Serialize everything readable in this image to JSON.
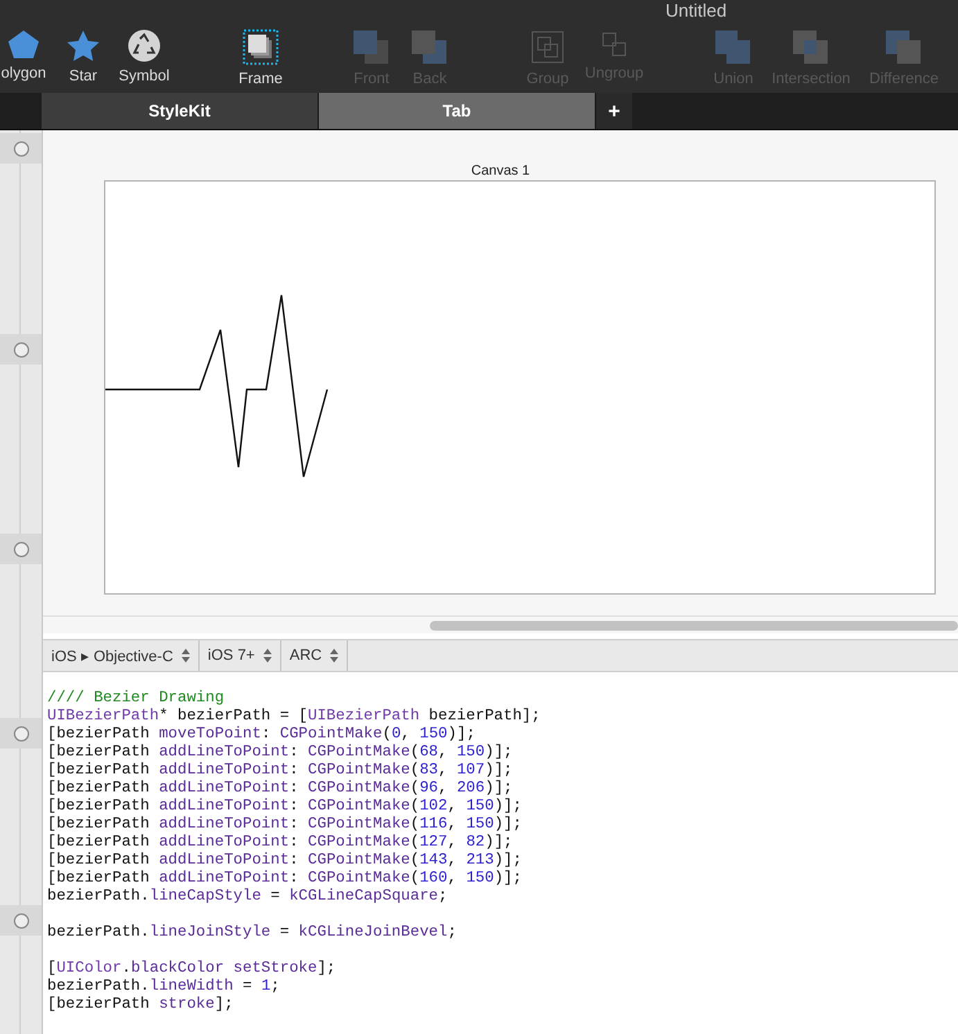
{
  "window": {
    "title": "Untitled"
  },
  "toolbar": {
    "groups": [
      {
        "items": [
          {
            "kind": "polygon",
            "label": "olygon",
            "disabled": false
          },
          {
            "kind": "star",
            "label": "Star",
            "disabled": false
          },
          {
            "kind": "symbol",
            "label": "Symbol",
            "disabled": false
          }
        ]
      },
      {
        "items": [
          {
            "kind": "frame",
            "label": "Frame",
            "disabled": false
          }
        ]
      },
      {
        "items": [
          {
            "kind": "front",
            "label": "Front",
            "disabled": true
          },
          {
            "kind": "back",
            "label": "Back",
            "disabled": true
          }
        ]
      },
      {
        "items": [
          {
            "kind": "group",
            "label": "Group",
            "disabled": true
          },
          {
            "kind": "ungroup",
            "label": "Ungroup",
            "disabled": true
          }
        ]
      },
      {
        "items": [
          {
            "kind": "union",
            "label": "Union",
            "disabled": true
          },
          {
            "kind": "intersection",
            "label": "Intersection",
            "disabled": true
          },
          {
            "kind": "difference",
            "label": "Difference",
            "disabled": true
          }
        ]
      }
    ]
  },
  "tabs": [
    {
      "label": "StyleKit",
      "selected": false
    },
    {
      "label": "Tab",
      "selected": true
    }
  ],
  "add_tab": "+",
  "canvas": {
    "title": "Canvas 1"
  },
  "code_options": [
    "iOS ▸ Objective-C",
    "iOS 7+",
    "ARC"
  ],
  "code": [
    {
      "lines": [
        [
          {
            "kind": "comment",
            "text": "//// Bezier Drawing"
          }
        ],
        [
          {
            "kind": "type",
            "text": "UIBezierPath"
          },
          {
            "kind": "plain",
            "text": "* bezierPath = ["
          },
          {
            "kind": "type",
            "text": "UIBezierPath"
          },
          {
            "kind": "plain",
            "text": " bezierPath];"
          }
        ],
        [
          {
            "kind": "plain",
            "text": "[bezierPath "
          },
          {
            "kind": "call",
            "text": "moveToPoint"
          },
          {
            "kind": "plain",
            "text": ": "
          },
          {
            "kind": "call",
            "text": "CGPointMake"
          },
          {
            "kind": "plain",
            "text": "("
          },
          {
            "kind": "number",
            "text": "0"
          },
          {
            "kind": "plain",
            "text": ", "
          },
          {
            "kind": "number",
            "text": "150"
          },
          {
            "kind": "plain",
            "text": ")];"
          }
        ],
        [
          {
            "kind": "plain",
            "text": "[bezierPath "
          },
          {
            "kind": "call",
            "text": "addLineToPoint"
          },
          {
            "kind": "plain",
            "text": ": "
          },
          {
            "kind": "call",
            "text": "CGPointMake"
          },
          {
            "kind": "plain",
            "text": "("
          },
          {
            "kind": "number",
            "text": "68"
          },
          {
            "kind": "plain",
            "text": ", "
          },
          {
            "kind": "number",
            "text": "150"
          },
          {
            "kind": "plain",
            "text": ")];"
          }
        ],
        [
          {
            "kind": "plain",
            "text": "[bezierPath "
          },
          {
            "kind": "call",
            "text": "addLineToPoint"
          },
          {
            "kind": "plain",
            "text": ": "
          },
          {
            "kind": "call",
            "text": "CGPointMake"
          },
          {
            "kind": "plain",
            "text": "("
          },
          {
            "kind": "number",
            "text": "83"
          },
          {
            "kind": "plain",
            "text": ", "
          },
          {
            "kind": "number",
            "text": "107"
          },
          {
            "kind": "plain",
            "text": ")];"
          }
        ],
        [
          {
            "kind": "plain",
            "text": "[bezierPath "
          },
          {
            "kind": "call",
            "text": "addLineToPoint"
          },
          {
            "kind": "plain",
            "text": ": "
          },
          {
            "kind": "call",
            "text": "CGPointMake"
          },
          {
            "kind": "plain",
            "text": "("
          },
          {
            "kind": "number",
            "text": "96"
          },
          {
            "kind": "plain",
            "text": ", "
          },
          {
            "kind": "number",
            "text": "206"
          },
          {
            "kind": "plain",
            "text": ")];"
          }
        ],
        [
          {
            "kind": "plain",
            "text": "[bezierPath "
          },
          {
            "kind": "call",
            "text": "addLineToPoint"
          },
          {
            "kind": "plain",
            "text": ": "
          },
          {
            "kind": "call",
            "text": "CGPointMake"
          },
          {
            "kind": "plain",
            "text": "("
          },
          {
            "kind": "number",
            "text": "102"
          },
          {
            "kind": "plain",
            "text": ", "
          },
          {
            "kind": "number",
            "text": "150"
          },
          {
            "kind": "plain",
            "text": ")];"
          }
        ],
        [
          {
            "kind": "plain",
            "text": "[bezierPath "
          },
          {
            "kind": "call",
            "text": "addLineToPoint"
          },
          {
            "kind": "plain",
            "text": ": "
          },
          {
            "kind": "call",
            "text": "CGPointMake"
          },
          {
            "kind": "plain",
            "text": "("
          },
          {
            "kind": "number",
            "text": "116"
          },
          {
            "kind": "plain",
            "text": ", "
          },
          {
            "kind": "number",
            "text": "150"
          },
          {
            "kind": "plain",
            "text": ")];"
          }
        ],
        [
          {
            "kind": "plain",
            "text": "[bezierPath "
          },
          {
            "kind": "call",
            "text": "addLineToPoint"
          },
          {
            "kind": "plain",
            "text": ": "
          },
          {
            "kind": "call",
            "text": "CGPointMake"
          },
          {
            "kind": "plain",
            "text": "("
          },
          {
            "kind": "number",
            "text": "127"
          },
          {
            "kind": "plain",
            "text": ", "
          },
          {
            "kind": "number",
            "text": "82"
          },
          {
            "kind": "plain",
            "text": ")];"
          }
        ],
        [
          {
            "kind": "plain",
            "text": "[bezierPath "
          },
          {
            "kind": "call",
            "text": "addLineToPoint"
          },
          {
            "kind": "plain",
            "text": ": "
          },
          {
            "kind": "call",
            "text": "CGPointMake"
          },
          {
            "kind": "plain",
            "text": "("
          },
          {
            "kind": "number",
            "text": "143"
          },
          {
            "kind": "plain",
            "text": ", "
          },
          {
            "kind": "number",
            "text": "213"
          },
          {
            "kind": "plain",
            "text": ")];"
          }
        ],
        [
          {
            "kind": "plain",
            "text": "[bezierPath "
          },
          {
            "kind": "call",
            "text": "addLineToPoint"
          },
          {
            "kind": "plain",
            "text": ": "
          },
          {
            "kind": "call",
            "text": "CGPointMake"
          },
          {
            "kind": "plain",
            "text": "("
          },
          {
            "kind": "number",
            "text": "160"
          },
          {
            "kind": "plain",
            "text": ", "
          },
          {
            "kind": "number",
            "text": "150"
          },
          {
            "kind": "plain",
            "text": ")];"
          }
        ],
        [
          {
            "kind": "plain",
            "text": "bezierPath."
          },
          {
            "kind": "call",
            "text": "lineCapStyle"
          },
          {
            "kind": "plain",
            "text": " = "
          },
          {
            "kind": "call",
            "text": "kCGLineCapSquare"
          },
          {
            "kind": "plain",
            "text": ";"
          }
        ]
      ]
    },
    {
      "lines": [
        [
          {
            "kind": "plain",
            "text": "bezierPath."
          },
          {
            "kind": "call",
            "text": "lineJoinStyle"
          },
          {
            "kind": "plain",
            "text": " = "
          },
          {
            "kind": "call",
            "text": "kCGLineJoinBevel"
          },
          {
            "kind": "plain",
            "text": ";"
          }
        ]
      ]
    },
    {
      "lines": [
        [
          {
            "kind": "plain",
            "text": "["
          },
          {
            "kind": "type",
            "text": "UIColor"
          },
          {
            "kind": "plain",
            "text": "."
          },
          {
            "kind": "call",
            "text": "blackColor"
          },
          {
            "kind": "call",
            "text": " setStroke"
          },
          {
            "kind": "plain",
            "text": "];"
          }
        ],
        [
          {
            "kind": "plain",
            "text": "bezierPath."
          },
          {
            "kind": "call",
            "text": "lineWidth"
          },
          {
            "kind": "plain",
            "text": " = "
          },
          {
            "kind": "number",
            "text": "1"
          },
          {
            "kind": "plain",
            "text": ";"
          }
        ],
        [
          {
            "kind": "plain",
            "text": "[bezierPath "
          },
          {
            "kind": "call",
            "text": "stroke"
          },
          {
            "kind": "plain",
            "text": "];"
          }
        ]
      ]
    }
  ]
}
